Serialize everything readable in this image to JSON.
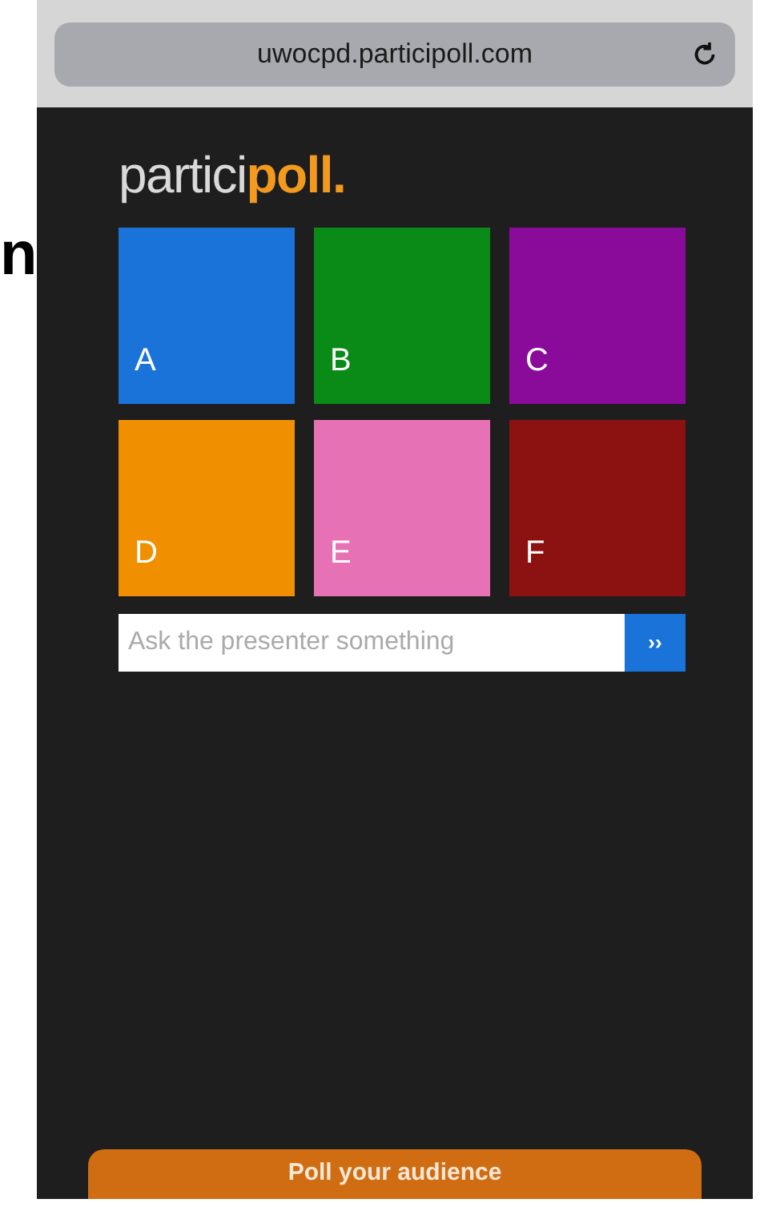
{
  "side_text": "n",
  "browser": {
    "url": "uwocpd.participoll.com"
  },
  "logo": "partici**poll.**",
  "tiles": [
    {
      "label": "A",
      "color": "#1a73d9"
    },
    {
      "label": "B",
      "color": "#0a8a16"
    },
    {
      "label": "C",
      "color": "#8a0a9a"
    },
    {
      "label": "D",
      "color": "#f09000"
    },
    {
      "label": "E",
      "color": "#e672b5"
    },
    {
      "label": "F",
      "color": "#8c1111"
    }
  ],
  "question": {
    "placeholder": "Ask the presenter something",
    "send": "››"
  },
  "footer_button": "Poll your audience"
}
